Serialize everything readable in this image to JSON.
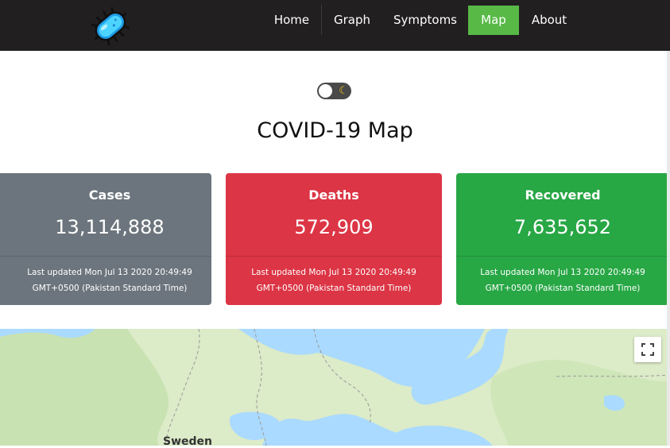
{
  "navbar": {
    "logo_icon": "virus-icon",
    "items": [
      "Home",
      "Graph",
      "Symptoms",
      "Map",
      "About"
    ],
    "active": "Map",
    "active_color": "#58b947"
  },
  "theme_toggle": {
    "state": "off",
    "icon": "moon-icon"
  },
  "page": {
    "title": "COVID-19 Map"
  },
  "cards": {
    "cases": {
      "label": "Cases",
      "value": "13,114,888",
      "updated": "Last updated Mon Jul 13 2020 20:49:49",
      "timezone": "GMT+0500 (Pakistan Standard Time)",
      "color": "#6c757d"
    },
    "deaths": {
      "label": "Deaths",
      "value": "572,909",
      "updated": "Last updated Mon Jul 13 2020 20:49:49",
      "timezone": "GMT+0500 (Pakistan Standard Time)",
      "color": "#dc3545"
    },
    "recovered": {
      "label": "Recovered",
      "value": "7,635,652",
      "updated": "Last updated Mon Jul 13 2020 20:49:49",
      "timezone": "GMT+0500 (Pakistan Standard Time)",
      "color": "#28a745"
    }
  },
  "map": {
    "visible_label": "Sweden",
    "fullscreen_icon": "fullscreen-icon"
  }
}
